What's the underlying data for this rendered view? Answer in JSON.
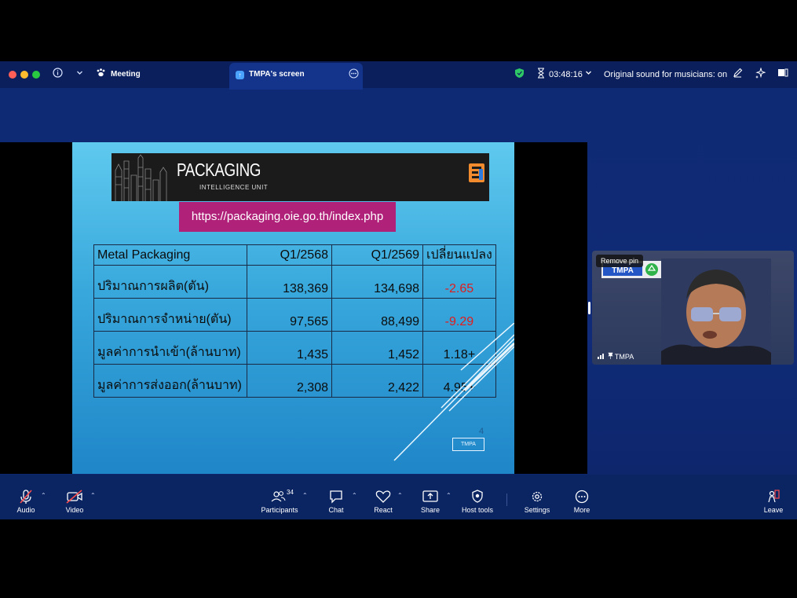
{
  "titlebar": {
    "meeting_label": "Meeting",
    "tab_label": "TMPA's screen",
    "timer": "03:48:16",
    "sound_status": "Original sound for musicians: on"
  },
  "slide": {
    "banner_title": "PACKAGING",
    "banner_subtitle": "INTELLIGENCE UNIT",
    "url": "https://packaging.oie.go.th/index.php",
    "table": {
      "headers": [
        "Metal Packaging",
        "Q1/2568",
        "Q1/2569",
        "เปลี่ยนแปลง"
      ],
      "rows": [
        {
          "label": "ปริมาณการผลิต(ตัน)",
          "q1_2568": "138,369",
          "q1_2569": "134,698",
          "change": "-2.65"
        },
        {
          "label": "ปริมาณการจำหน่าย(ตัน)",
          "q1_2568": "97,565",
          "q1_2569": "88,499",
          "change": "-9.29"
        },
        {
          "label": "มูลค่าการนำเข้า(ล้านบาท)",
          "q1_2568": "1,435",
          "q1_2569": "1,452",
          "change": "1.18+"
        },
        {
          "label": "มูลค่าการส่งออก(ล้านบาท)",
          "q1_2568": "2,308",
          "q1_2569": "2,422",
          "change": "4.95+"
        }
      ]
    },
    "slide_number": "4",
    "footer_tag": "TMPA"
  },
  "participant": {
    "remove_pin_label": "Remove pin",
    "name": "TMPA",
    "logo_text": "TMPA"
  },
  "toolbar": {
    "audio": "Audio",
    "video": "Video",
    "participants": "Participants",
    "participants_count": "34",
    "chat": "Chat",
    "react": "React",
    "share": "Share",
    "host_tools": "Host tools",
    "settings": "Settings",
    "more": "More",
    "leave": "Leave"
  },
  "colors": {
    "app_background": "#0f2a73",
    "slide_background": "#38a8dc",
    "url_box": "#b0227a",
    "negative_value": "#e21b1b",
    "security_shield": "#2ec866"
  }
}
